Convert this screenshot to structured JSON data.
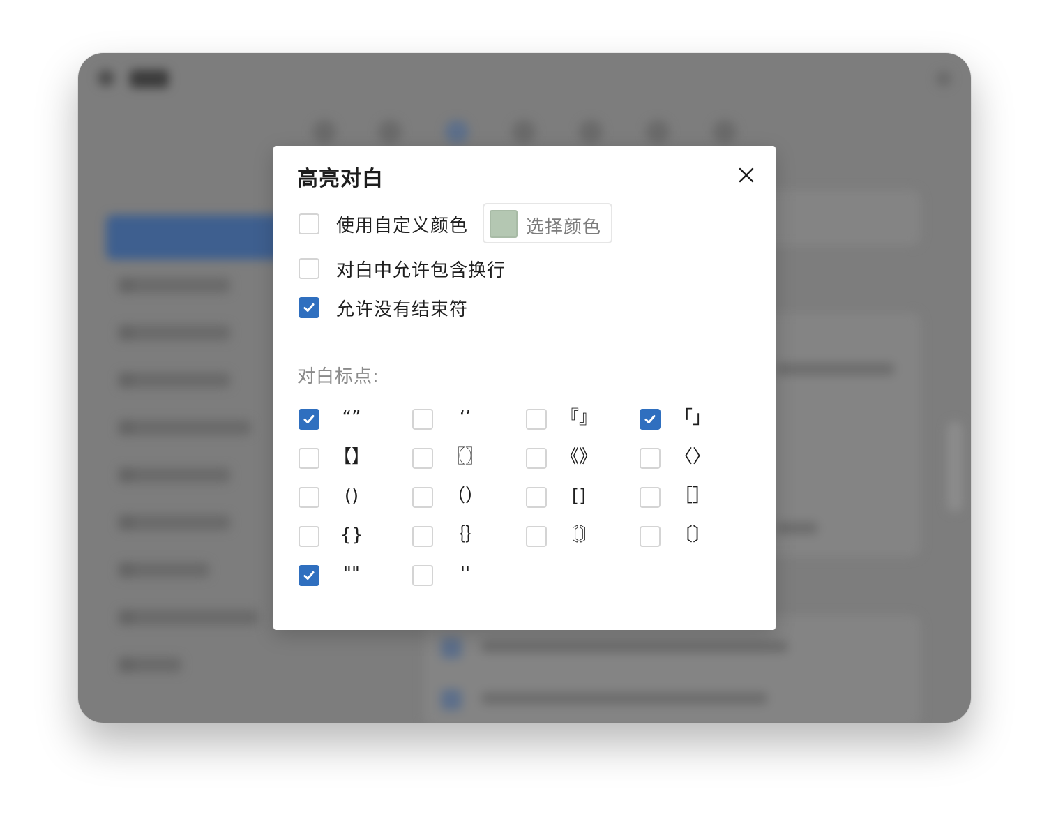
{
  "dialog": {
    "title": "高亮对白",
    "close_icon": "close-icon",
    "options": [
      {
        "label": "使用自定义颜色",
        "checked": false
      },
      {
        "label": "对白中允许包含换行",
        "checked": false
      },
      {
        "label": "允许没有结束符",
        "checked": true
      }
    ],
    "color_button": {
      "label": "选择颜色",
      "swatch_color": "#b4c7b2"
    },
    "punct_section_label": "对白标点:",
    "punctuation": [
      {
        "symbol": "“”",
        "checked": true
      },
      {
        "symbol": "‘’",
        "checked": false
      },
      {
        "symbol": "『』",
        "checked": false
      },
      {
        "symbol": "「」",
        "checked": true
      },
      {
        "symbol": "【】",
        "checked": false
      },
      {
        "symbol": "〖〗",
        "checked": false
      },
      {
        "symbol": "《》",
        "checked": false
      },
      {
        "symbol": "〈〉",
        "checked": false
      },
      {
        "symbol": "()",
        "checked": false
      },
      {
        "symbol": "（）",
        "checked": false
      },
      {
        "symbol": "[]",
        "checked": false
      },
      {
        "symbol": "［］",
        "checked": false
      },
      {
        "symbol": "{}",
        "checked": false
      },
      {
        "symbol": "｛｝",
        "checked": false
      },
      {
        "symbol": "〘〙",
        "checked": false
      },
      {
        "symbol": "〔〕",
        "checked": false
      },
      {
        "symbol": "\"\"",
        "checked": true
      },
      {
        "symbol": "''",
        "checked": false
      }
    ]
  },
  "colors": {
    "accent": "#2f6fbf",
    "overlay": "#7d7d7d"
  }
}
